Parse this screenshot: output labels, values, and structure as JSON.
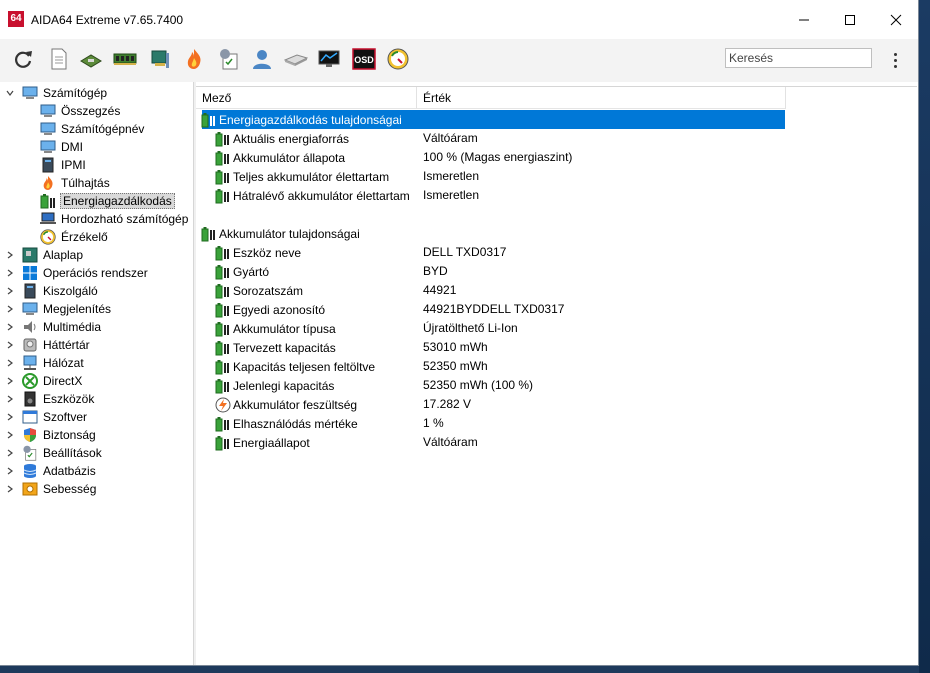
{
  "window": {
    "app_icon_text": "64",
    "title": "AIDA64 Extreme v7.65.7400"
  },
  "toolbar": {
    "buttons": [
      "refresh-icon",
      "report-icon",
      "motherboard-icon",
      "memory-icon",
      "pci-device-icon",
      "overclock-flame-icon",
      "benchmark-checklist-icon",
      "user-icon",
      "disk-icon",
      "monitor-icon",
      "osd-icon",
      "sensor-gauge-icon"
    ],
    "osd_label": "OSD",
    "search_placeholder": "Keresés"
  },
  "tree": {
    "root": "Számítógép",
    "children": [
      "Összegzés",
      "Számítógépnév",
      "DMI",
      "IPMI",
      "Túlhajtás",
      "Energiagazdálkodás",
      "Hordozható számítógép",
      "Érzékelő"
    ],
    "selected": "Energiagazdálkodás",
    "categories": [
      "Alaplap",
      "Operációs rendszer",
      "Kiszolgáló",
      "Megjelenítés",
      "Multimédia",
      "Háttértár",
      "Hálózat",
      "DirectX",
      "Eszközök",
      "Szoftver",
      "Biztonság",
      "Beállítások",
      "Adatbázis",
      "Sebesség"
    ]
  },
  "grid": {
    "columns": [
      "Mező",
      "Érték"
    ],
    "section1": {
      "title": "Energiagazdálkodás tulajdonságai",
      "rows": [
        {
          "field": "Aktuális energiaforrás",
          "value": "Váltóáram"
        },
        {
          "field": "Akkumulátor állapota",
          "value": "100 % (Magas energiaszint)"
        },
        {
          "field": "Teljes akkumulátor élettartam",
          "value": "Ismeretlen"
        },
        {
          "field": "Hátralévő akkumulátor élettartam",
          "value": "Ismeretlen"
        }
      ]
    },
    "section2": {
      "title": "Akkumulátor tulajdonságai",
      "rows": [
        {
          "field": "Eszköz neve",
          "value": "DELL TXD0317"
        },
        {
          "field": "Gyártó",
          "value": "BYD"
        },
        {
          "field": "Sorozatszám",
          "value": "44921"
        },
        {
          "field": "Egyedi azonosító",
          "value": "44921BYDDELL TXD0317"
        },
        {
          "field": "Akkumulátor típusa",
          "value": "Újratölthető Li-Ion"
        },
        {
          "field": "Tervezett kapacitás",
          "value": "53010 mWh"
        },
        {
          "field": "Kapacitás teljesen feltöltve",
          "value": "52350 mWh"
        },
        {
          "field": "Jelenlegi kapacitás",
          "value": "52350 mWh  (100 %)"
        },
        {
          "field": "Akkumulátor feszültség",
          "value": "17.282 V",
          "icon": "voltage-icon"
        },
        {
          "field": "Elhasználódás mértéke",
          "value": "1 %"
        },
        {
          "field": "Energiaállapot",
          "value": "Váltóáram"
        }
      ]
    }
  },
  "colors": {
    "selection": "#0078d7",
    "battery_green": "#3aa23a",
    "desktop": "#1e3a5c"
  }
}
